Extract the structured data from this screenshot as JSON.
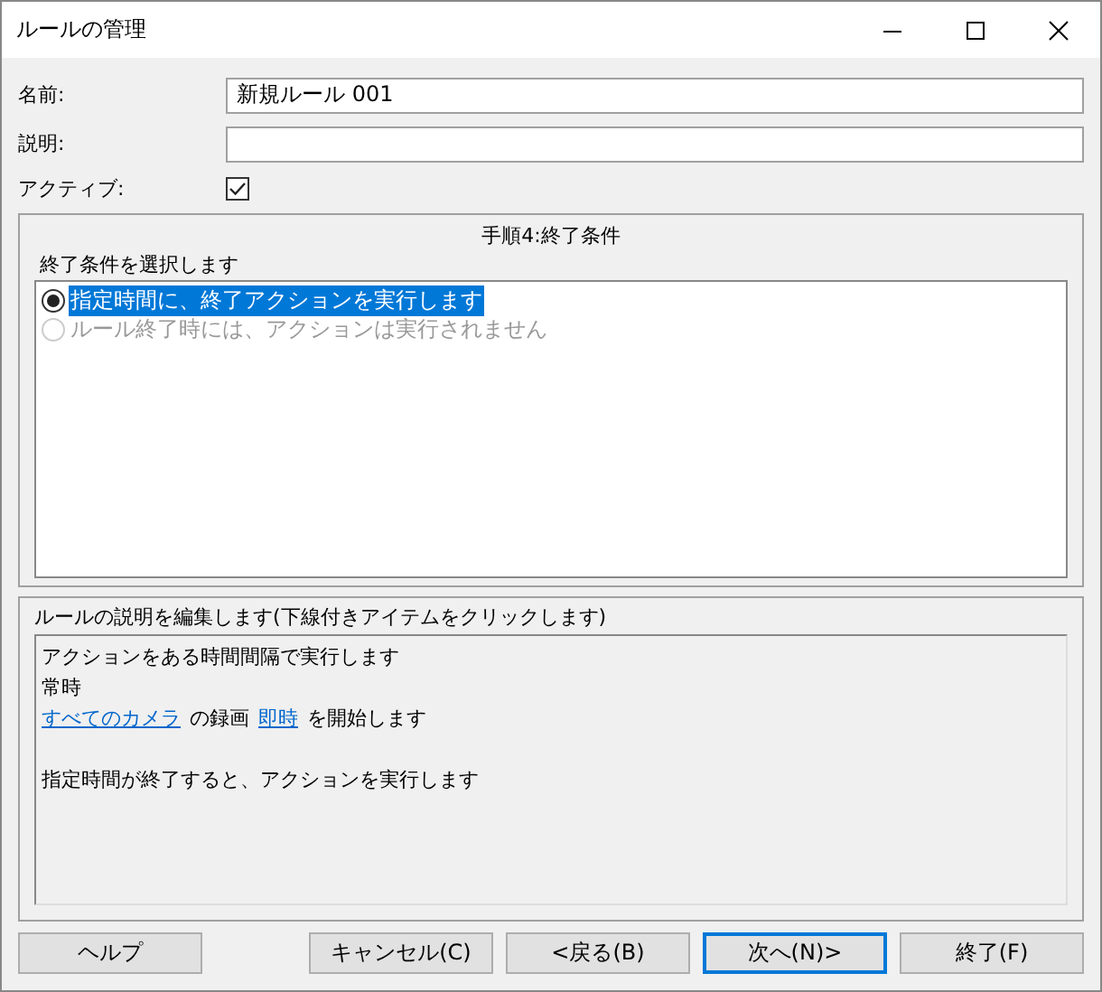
{
  "window": {
    "title": "ルールの管理"
  },
  "fields": [
    {
      "kind": "text",
      "label": "名前:",
      "value": "新規ルール 001"
    },
    {
      "kind": "text",
      "label": "説明:"
    },
    {
      "kind": "checkbox",
      "label": "アクティブ:",
      "checked": true
    }
  ],
  "step_panel": {
    "heading": "手順4:終了条件",
    "prompt": "終了条件を選択します",
    "options": [
      {
        "label": "指定時間に、終了アクションを実行します",
        "selected": true,
        "disabled": false
      },
      {
        "label": "ルール終了時には、アクションは実行されません",
        "selected": false,
        "disabled": true
      }
    ]
  },
  "description_panel": {
    "heading": "ルールの説明を編集します(下線付きアイテムをクリックします)",
    "paragraphs": [
      {
        "lines": [
          {
            "parts": [
              {
                "kind": "text",
                "text": "アクションをある時間間隔で実行します"
              }
            ]
          },
          {
            "parts": [
              {
                "kind": "text",
                "text": "常時"
              }
            ]
          },
          {
            "parts": [
              {
                "kind": "link",
                "text": "すべてのカメラ"
              },
              {
                "kind": "text",
                "text": "の録画"
              },
              {
                "kind": "link",
                "text": "即時"
              },
              {
                "kind": "text",
                "text": "を開始します"
              }
            ]
          }
        ]
      },
      {
        "lines": [
          {
            "parts": [
              {
                "kind": "text",
                "text": "指定時間が終了すると、アクションを実行します"
              }
            ]
          }
        ]
      }
    ]
  },
  "buttons": [
    {
      "label": "ヘルプ",
      "default": false
    },
    {
      "label": "キャンセル(C)",
      "default": false
    },
    {
      "label": "<戻る(B)",
      "default": false
    },
    {
      "label": "次へ(N)>",
      "default": true
    },
    {
      "label": "終了(F)",
      "default": false
    }
  ]
}
